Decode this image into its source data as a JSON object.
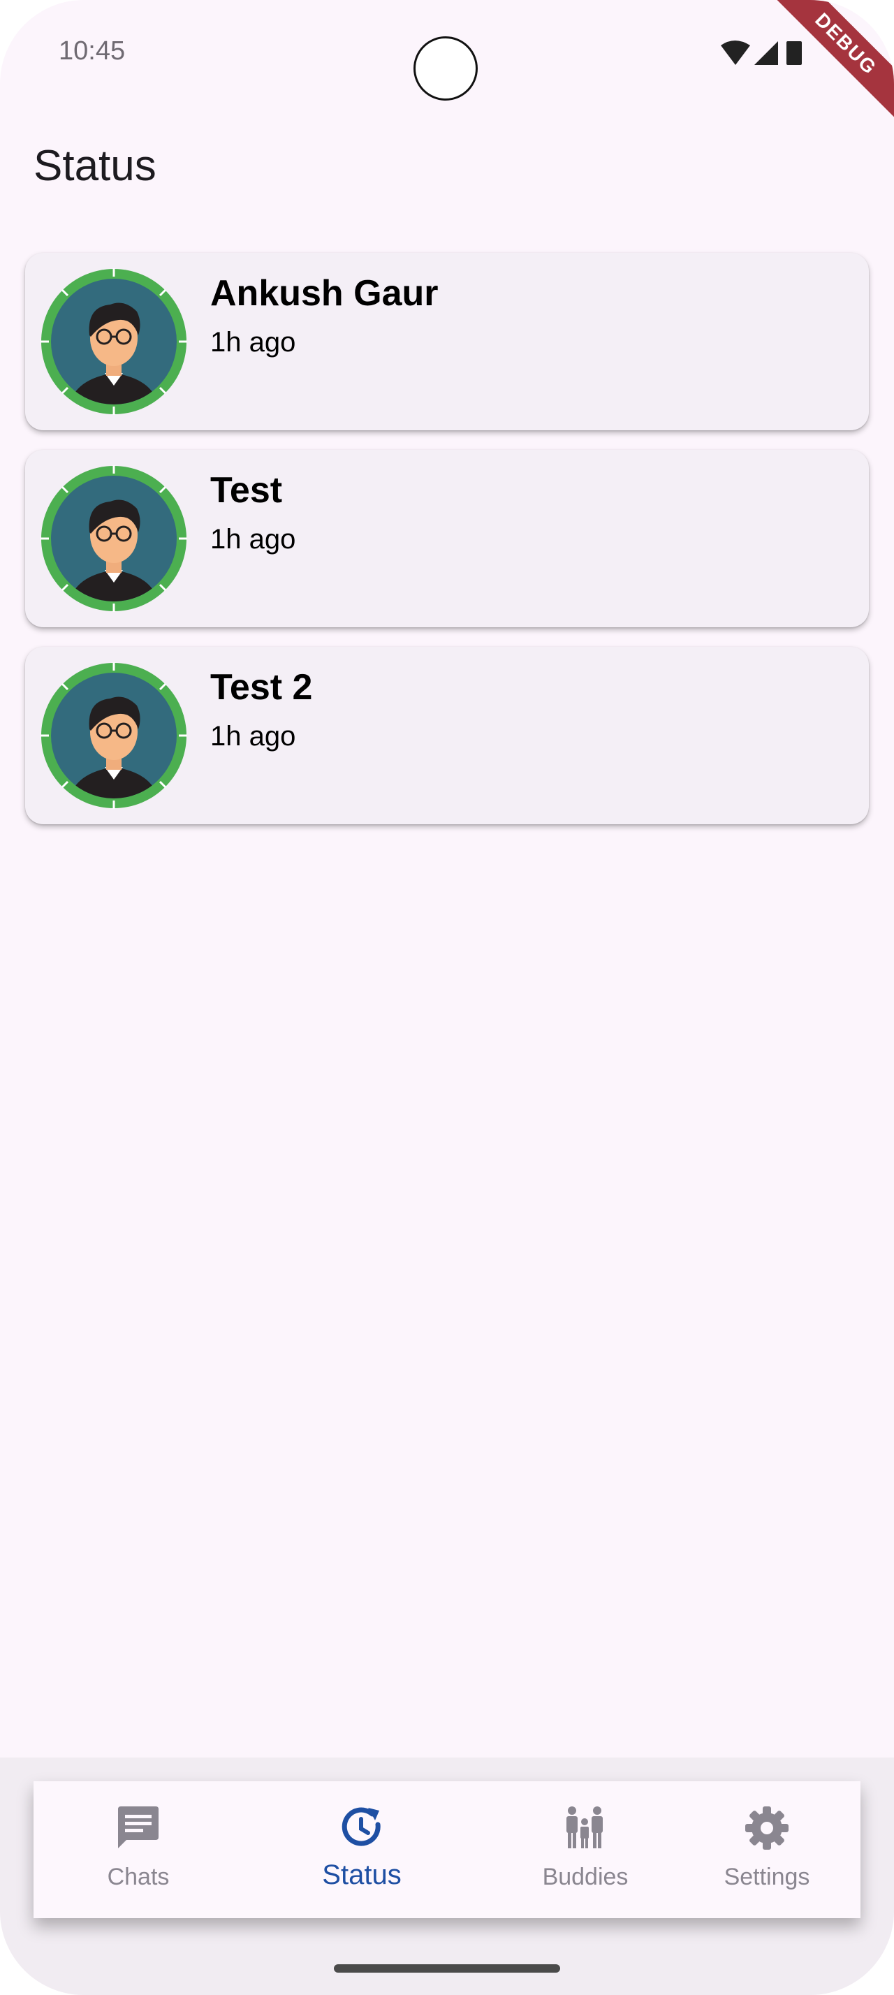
{
  "status_bar": {
    "time": "10:45",
    "debug_label": "DEBUG"
  },
  "header": {
    "title": "Status"
  },
  "statuses": [
    {
      "name": "Ankush Gaur",
      "time": "1h ago"
    },
    {
      "name": "Test",
      "time": "1h ago"
    },
    {
      "name": "Test 2",
      "time": "1h ago"
    }
  ],
  "nav": {
    "items": [
      {
        "label": "Chats",
        "icon": "chat-icon"
      },
      {
        "label": "Status",
        "icon": "status-update-icon",
        "active": true
      },
      {
        "label": "Buddies",
        "icon": "people-icon"
      },
      {
        "label": "Settings",
        "icon": "gear-icon"
      }
    ]
  },
  "colors": {
    "background": "#fcf5fc",
    "card": "#f4eff6",
    "ring": "#4caf50",
    "active_nav": "#1e4fa3",
    "inactive_nav": "#8a8690",
    "avatar_bg": "#336b7d"
  }
}
